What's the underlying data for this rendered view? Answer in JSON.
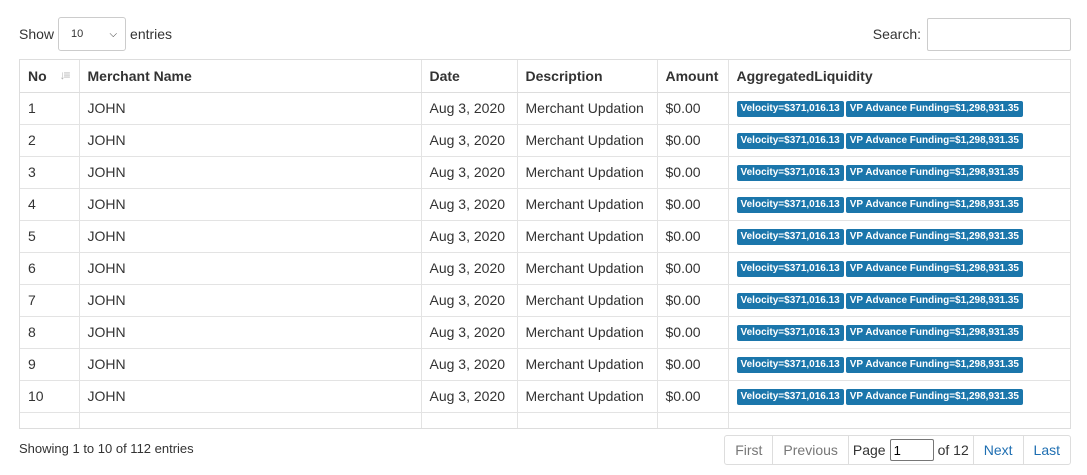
{
  "length": {
    "show_label": "Show",
    "selected": "10",
    "entries_label": "entries"
  },
  "search": {
    "label": "Search:",
    "value": ""
  },
  "table": {
    "headers": [
      "No",
      "Merchant Name",
      "Date",
      "Description",
      "Amount",
      "AggregatedLiquidity"
    ],
    "rows": [
      {
        "no": "1",
        "name": "JOHN",
        "date": "Aug 3, 2020",
        "desc": "Merchant Updation",
        "amount": "$0.00",
        "badges": [
          "Velocity=$371,016.13",
          "VP Advance Funding=$1,298,931.35"
        ]
      },
      {
        "no": "2",
        "name": "JOHN",
        "date": "Aug 3, 2020",
        "desc": "Merchant Updation",
        "amount": "$0.00",
        "badges": [
          "Velocity=$371,016.13",
          "VP Advance Funding=$1,298,931.35"
        ]
      },
      {
        "no": "3",
        "name": "JOHN",
        "date": "Aug 3, 2020",
        "desc": "Merchant Updation",
        "amount": "$0.00",
        "badges": [
          "Velocity=$371,016.13",
          "VP Advance Funding=$1,298,931.35"
        ]
      },
      {
        "no": "4",
        "name": "JOHN",
        "date": "Aug 3, 2020",
        "desc": "Merchant Updation",
        "amount": "$0.00",
        "badges": [
          "Velocity=$371,016.13",
          "VP Advance Funding=$1,298,931.35"
        ]
      },
      {
        "no": "5",
        "name": "JOHN",
        "date": "Aug 3, 2020",
        "desc": "Merchant Updation",
        "amount": "$0.00",
        "badges": [
          "Velocity=$371,016.13",
          "VP Advance Funding=$1,298,931.35"
        ]
      },
      {
        "no": "6",
        "name": "JOHN",
        "date": "Aug 3, 2020",
        "desc": "Merchant Updation",
        "amount": "$0.00",
        "badges": [
          "Velocity=$371,016.13",
          "VP Advance Funding=$1,298,931.35"
        ]
      },
      {
        "no": "7",
        "name": "JOHN",
        "date": "Aug 3, 2020",
        "desc": "Merchant Updation",
        "amount": "$0.00",
        "badges": [
          "Velocity=$371,016.13",
          "VP Advance Funding=$1,298,931.35"
        ]
      },
      {
        "no": "8",
        "name": "JOHN",
        "date": "Aug 3, 2020",
        "desc": "Merchant Updation",
        "amount": "$0.00",
        "badges": [
          "Velocity=$371,016.13",
          "VP Advance Funding=$1,298,931.35"
        ]
      },
      {
        "no": "9",
        "name": "JOHN",
        "date": "Aug 3, 2020",
        "desc": "Merchant Updation",
        "amount": "$0.00",
        "badges": [
          "Velocity=$371,016.13",
          "VP Advance Funding=$1,298,931.35"
        ]
      },
      {
        "no": "10",
        "name": "JOHN",
        "date": "Aug 3, 2020",
        "desc": "Merchant Updation",
        "amount": "$0.00",
        "badges": [
          "Velocity=$371,016.13",
          "VP Advance Funding=$1,298,931.35"
        ]
      }
    ]
  },
  "info": "Showing 1 to 10 of 112 entries",
  "pager": {
    "first": "First",
    "previous": "Previous",
    "page_label": "Page",
    "page_value": "1",
    "of_label": "of 12",
    "next": "Next",
    "last": "Last"
  },
  "colors": {
    "badge": "#1b76ab",
    "link": "#1f6fb2",
    "border": "#dddddd"
  },
  "icons": {
    "sort": "sort-amount-down-icon",
    "select": "chevron-down-icon"
  }
}
